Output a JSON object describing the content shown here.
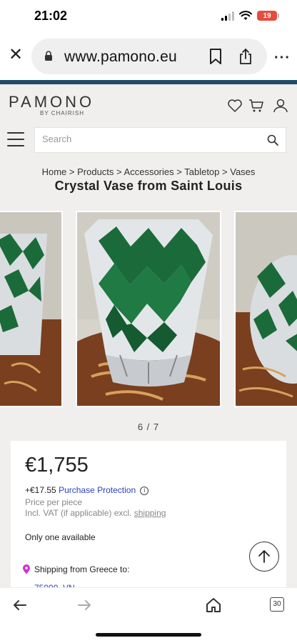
{
  "status_bar": {
    "time": "21:02",
    "battery": "19"
  },
  "browser": {
    "url": "www.pamono.eu",
    "open_tabs": "30"
  },
  "site": {
    "logo": "PAMONO",
    "logo_sub": "BY CHAIRISH"
  },
  "search": {
    "placeholder": "Search"
  },
  "breadcrumb": {
    "items": [
      "Home",
      "Products",
      "Accessories",
      "Tabletop",
      "Vases"
    ],
    "separator": ">"
  },
  "product": {
    "title": "Crystal Vase from Saint Louis",
    "image_counter": "6 / 7",
    "price": "€1,755",
    "protection_amount": "+€17.55",
    "protection_label": "Purchase Protection",
    "price_unit_note": "Price per piece",
    "vat_note_prefix": "Incl. VAT (if applicable) excl.",
    "vat_note_link": "shipping",
    "availability": "Only one available",
    "shipping_from": "Shipping from Greece to:",
    "shipping_to": "75000, VN"
  },
  "colors": {
    "brand_stripe": "#1f4c66",
    "link": "#2b3fbf",
    "vase_green": "#1b6b3a",
    "table_wood": "#8a4a22"
  }
}
